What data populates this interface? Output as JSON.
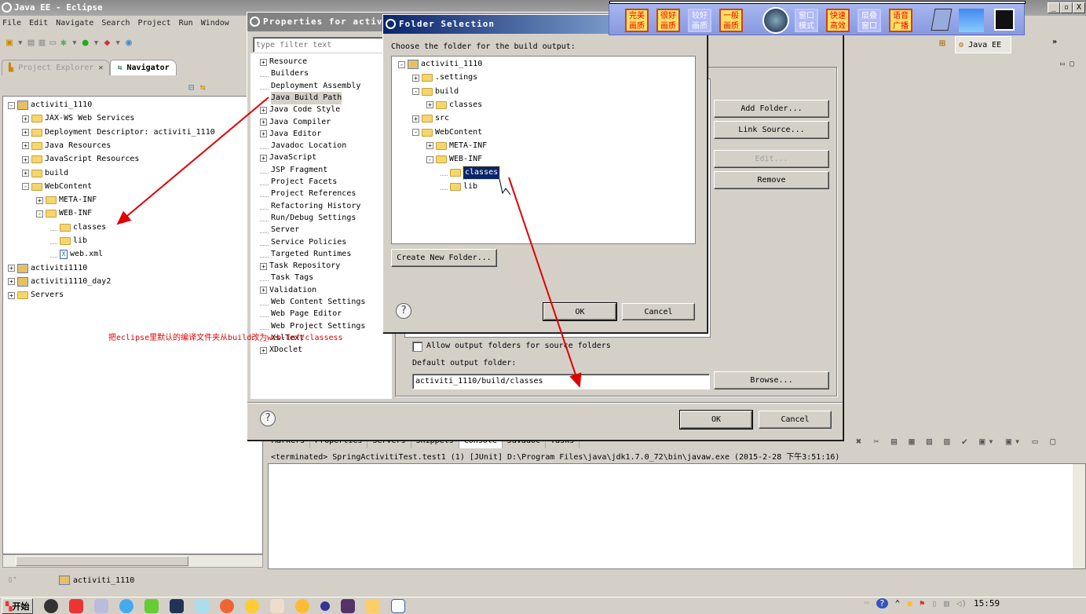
{
  "window": {
    "title": "Java EE - Eclipse",
    "min": "_",
    "restore": "▫",
    "close": "X"
  },
  "menu": [
    "File",
    "Edit",
    "Navigate",
    "Search",
    "Project",
    "Run",
    "Window"
  ],
  "perspective": {
    "label": "Java EE",
    "overflow": "»"
  },
  "explorer": {
    "tabs": [
      {
        "label": "Project Explorer",
        "active": true
      },
      {
        "label": "Navigator",
        "active": false
      }
    ],
    "items": [
      {
        "label": "activiti_1110",
        "level": 0,
        "exp": "-",
        "icon": "project"
      },
      {
        "label": "JAX-WS Web Services",
        "level": 1,
        "exp": "+",
        "icon": "service"
      },
      {
        "label": "Deployment Descriptor: activiti_1110",
        "level": 1,
        "exp": "+",
        "icon": "descriptor"
      },
      {
        "label": "Java Resources",
        "level": 1,
        "exp": "+",
        "icon": "java-res"
      },
      {
        "label": "JavaScript Resources",
        "level": 1,
        "exp": "+",
        "icon": "js-res"
      },
      {
        "label": "build",
        "level": 1,
        "exp": "+",
        "icon": "folder"
      },
      {
        "label": "WebContent",
        "level": 1,
        "exp": "-",
        "icon": "folder"
      },
      {
        "label": "META-INF",
        "level": 2,
        "exp": "+",
        "icon": "folder"
      },
      {
        "label": "WEB-INF",
        "level": 2,
        "exp": "-",
        "icon": "folder"
      },
      {
        "label": "classes",
        "level": 3,
        "exp": "",
        "icon": "folder"
      },
      {
        "label": "lib",
        "level": 3,
        "exp": "",
        "icon": "folder"
      },
      {
        "label": "web.xml",
        "level": 3,
        "exp": "",
        "icon": "xml-file"
      },
      {
        "label": "activiti1110",
        "level": 0,
        "exp": "+",
        "icon": "project"
      },
      {
        "label": "activiti1110_day2",
        "level": 0,
        "exp": "+",
        "icon": "project"
      },
      {
        "label": "Servers",
        "level": 0,
        "exp": "+",
        "icon": "folder"
      }
    ]
  },
  "annotation": "把eclipse里默认的编译文件夹从build改为web-inf/classess",
  "properties": {
    "title": "Properties for activi",
    "filter_placeholder": "type filter text",
    "items": [
      {
        "label": "Resource",
        "exp": "+"
      },
      {
        "label": "Builders",
        "exp": ""
      },
      {
        "label": "Deployment Assembly",
        "exp": ""
      },
      {
        "label": "Java Build Path",
        "exp": "",
        "selected": true
      },
      {
        "label": "Java Code Style",
        "exp": "+"
      },
      {
        "label": "Java Compiler",
        "exp": "+"
      },
      {
        "label": "Java Editor",
        "exp": "+"
      },
      {
        "label": "Javadoc Location",
        "exp": ""
      },
      {
        "label": "JavaScript",
        "exp": "+"
      },
      {
        "label": "JSP Fragment",
        "exp": ""
      },
      {
        "label": "Project Facets",
        "exp": ""
      },
      {
        "label": "Project References",
        "exp": ""
      },
      {
        "label": "Refactoring History",
        "exp": ""
      },
      {
        "label": "Run/Debug Settings",
        "exp": ""
      },
      {
        "label": "Server",
        "exp": ""
      },
      {
        "label": "Service Policies",
        "exp": ""
      },
      {
        "label": "Targeted Runtimes",
        "exp": ""
      },
      {
        "label": "Task Repository",
        "exp": "+"
      },
      {
        "label": "Task Tags",
        "exp": ""
      },
      {
        "label": "Validation",
        "exp": "+"
      },
      {
        "label": "Web Content Settings",
        "exp": ""
      },
      {
        "label": "Web Page Editor",
        "exp": ""
      },
      {
        "label": "Web Project Settings",
        "exp": ""
      },
      {
        "label": "XslText",
        "exp": ""
      },
      {
        "label": "XDoclet",
        "exp": "+"
      }
    ],
    "buttons": {
      "add_folder": "Add Folder...",
      "link_source": "Link Source...",
      "edit": "Edit...",
      "remove": "Remove",
      "browse": "Browse...",
      "ok": "OK",
      "cancel": "Cancel"
    },
    "allow_output": {
      "label": "Allow output folders for source folders",
      "checked": false
    },
    "default_output_label": "Default output folder:",
    "default_output_value": "activiti_1110/build/classes"
  },
  "folder_selection": {
    "title": "Folder Selection",
    "prompt": "Choose the folder for the build output:",
    "items": [
      {
        "label": "activiti_1110",
        "level": 0,
        "exp": "-",
        "icon": "project"
      },
      {
        "label": ".settings",
        "level": 1,
        "exp": "+",
        "icon": "folder"
      },
      {
        "label": "build",
        "level": 1,
        "exp": "-",
        "icon": "folder"
      },
      {
        "label": "classes",
        "level": 2,
        "exp": "+",
        "icon": "folder"
      },
      {
        "label": "src",
        "level": 1,
        "exp": "+",
        "icon": "folder"
      },
      {
        "label": "WebContent",
        "level": 1,
        "exp": "-",
        "icon": "folder"
      },
      {
        "label": "META-INF",
        "level": 2,
        "exp": "+",
        "icon": "folder"
      },
      {
        "label": "WEB-INF",
        "level": 2,
        "exp": "-",
        "icon": "folder"
      },
      {
        "label": "classes",
        "level": 3,
        "exp": "",
        "icon": "folder",
        "selected": true
      },
      {
        "label": "lib",
        "level": 3,
        "exp": "",
        "icon": "folder"
      }
    ],
    "create_folder": "Create New Folder...",
    "ok": "OK",
    "cancel": "Cancel"
  },
  "floating_toolbar": {
    "buttons": [
      {
        "label": "完美画质",
        "active": true
      },
      {
        "label": "很好画质",
        "active": true
      },
      {
        "label": "较好画质",
        "active": false
      },
      {
        "label": "一般画质",
        "active": true
      },
      {
        "label": "窗口模式",
        "active": false
      },
      {
        "label": "快速高效",
        "active": true
      },
      {
        "label": "层叠窗口",
        "active": false
      },
      {
        "label": "语音广播",
        "active": true
      }
    ]
  },
  "console": {
    "tabs": [
      "Markers",
      "Properties",
      "Servers",
      "Snippets",
      "Console",
      "Javadoc",
      "Tasks"
    ],
    "active_tab": "Console",
    "status": "<terminated> SpringActivitiTest.test1 (1) [JUnit] D:\\Program Files\\java\\jdk1.7.0_72\\bin\\javaw.exe (2015-2-28 下午3:51:16)"
  },
  "statusbar": {
    "project": "activiti_1110"
  },
  "taskbar": {
    "start": "开始",
    "clock": "15:59"
  },
  "colors": {
    "annotation": "#e00000",
    "dialog_title_active": "#0a246a",
    "selection": "#0a246a"
  }
}
